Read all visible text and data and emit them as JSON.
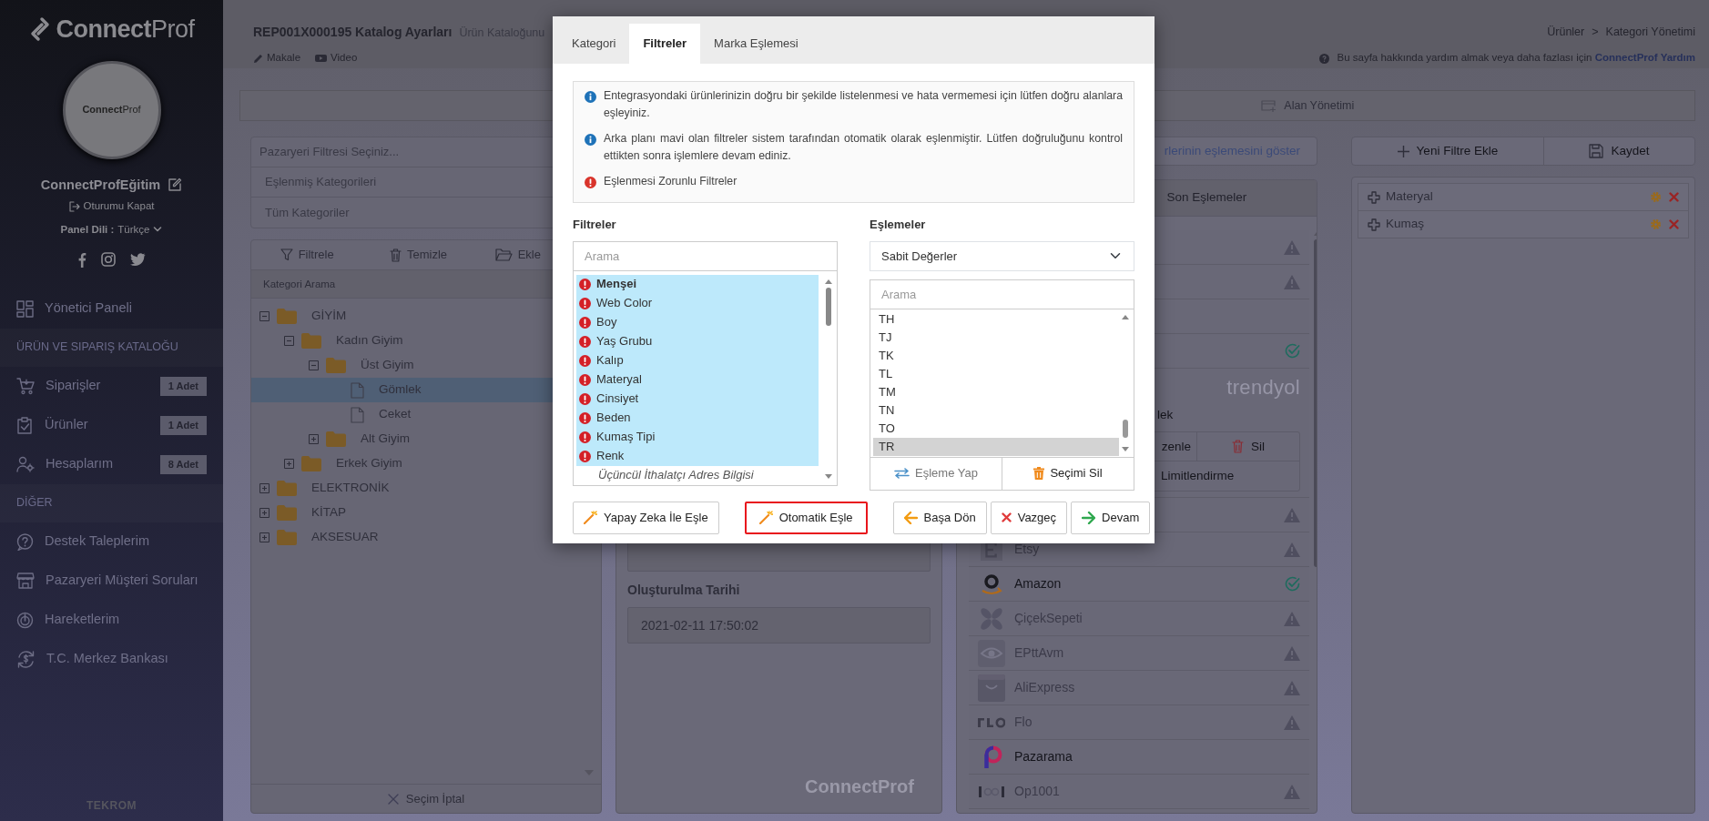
{
  "sidebar": {
    "logo": "**Connect**Prof",
    "avatar_logo": "**Connect**Prof",
    "user": "ConnectProfEğitim",
    "logout": "Oturumu Kapat",
    "language_label": "Panel Dili :",
    "language": "Türkçe",
    "menu": [
      {
        "kind": "item",
        "label": "Yönetici Paneli"
      },
      {
        "kind": "section",
        "label": "ÜRÜN VE SIPARIŞ KATALOĞU"
      },
      {
        "kind": "item",
        "label": "Siparişler",
        "badge": "1 Adet"
      },
      {
        "kind": "item",
        "label": "Ürünler",
        "badge": "1 Adet"
      },
      {
        "kind": "item",
        "label": "Hesaplarım",
        "badge": "8 Adet"
      },
      {
        "kind": "section",
        "label": "DİĞER"
      },
      {
        "kind": "item",
        "label": "Destek Taleplerim"
      },
      {
        "kind": "item",
        "label": "Pazaryeri Müşteri Soruları"
      },
      {
        "kind": "item",
        "label": "Hareketlerim"
      },
      {
        "kind": "item",
        "label": "T.C. Merkez Bankası"
      }
    ],
    "footer": "TEKROM"
  },
  "header": {
    "title": "REP001X000195 Katalog Ayarları",
    "subtitle": "Ürün Kataloğunu",
    "breadcrumb": [
      "Ürünler",
      "Kategori Yönetimi"
    ],
    "breadcrumb_separator": ">",
    "links": [
      "Makale",
      "Video"
    ],
    "help_text": "Bu sayfa hakkında yardım almak veya daha fazlası için",
    "help_link": "ConnectProf Yardım"
  },
  "page_tab": "Alan Yönetimi",
  "category_panel": {
    "filters": [
      "Pazaryeri Filtresi Seçiniz...",
      "Eşlenmiş Kategorileri",
      "Tüm Kategoriler"
    ],
    "toolbar": [
      "Filtrele",
      "Temizle",
      "Ekle"
    ],
    "search_placeholder": "Kategori Arama",
    "tree": [
      {
        "kind": "folder",
        "label": "GİYİM",
        "expanded": true,
        "selected": false,
        "children": [
          {
            "kind": "folder",
            "label": "Kadın Giyim",
            "expanded": true,
            "selected": false,
            "children": [
              {
                "kind": "folder",
                "label": "Üst Giyim",
                "expanded": true,
                "selected": false,
                "children": [
                  {
                    "kind": "file",
                    "label": "Gömlek",
                    "selected": true
                  },
                  {
                    "kind": "file",
                    "label": "Ceket",
                    "selected": false
                  }
                ]
              },
              {
                "kind": "folder",
                "label": "Alt Giyim",
                "expanded": false,
                "selected": false
              }
            ]
          },
          {
            "kind": "folder",
            "label": "Erkek Giyim",
            "expanded": false,
            "selected": false
          }
        ]
      },
      {
        "kind": "folder",
        "label": "ELEKTRONİK",
        "expanded": false,
        "selected": false
      },
      {
        "kind": "folder",
        "label": "KİTAP",
        "expanded": false,
        "selected": false
      },
      {
        "kind": "folder",
        "label": "AKSESUAR",
        "expanded": false,
        "selected": false
      }
    ],
    "cancel": "Seçim İptal"
  },
  "details": {
    "created_label": "Oluşturulma Tarihi",
    "created_value": "2021-02-11 17:50:02",
    "brand": "ConnectProf"
  },
  "mappings_panel": {
    "show_link": "rlerinin eşlemesini göster",
    "tab": "Son Eşlemeler",
    "marketplaces": [
      {
        "kind": "row",
        "warning": true,
        "verified": false
      },
      {
        "kind": "row",
        "warning": true,
        "verified": false
      },
      {
        "kind": "row",
        "warning": false,
        "verified": false
      },
      {
        "kind": "row",
        "warning": false,
        "verified": true
      },
      {
        "kind": "expanded",
        "logo": "trendyol",
        "product": "lek",
        "actions": [
          "zenle",
          "Sil"
        ],
        "limit": "Limitlendirme"
      },
      {
        "kind": "row",
        "warning": true,
        "verified": false
      },
      {
        "kind": "row",
        "name": "Etsy",
        "warning": true,
        "verified": false
      },
      {
        "kind": "row",
        "name": "Amazon",
        "warning": false,
        "verified": true
      },
      {
        "kind": "row",
        "name": "ÇiçekSepeti",
        "warning": true,
        "verified": false
      },
      {
        "kind": "row",
        "name": "EPttAvm",
        "warning": true,
        "verified": false
      },
      {
        "kind": "row",
        "name": "AliExpress",
        "warning": true,
        "verified": false
      },
      {
        "kind": "row",
        "name": "Flo",
        "warning": true,
        "verified": false
      },
      {
        "kind": "row",
        "name": "Pazarama",
        "warning": false,
        "verified": false
      },
      {
        "kind": "row",
        "name": "Op1001",
        "warning": true,
        "verified": false
      }
    ]
  },
  "filters_panel": {
    "buttons": [
      "Yeni Filtre Ekle",
      "Kaydet"
    ],
    "items": [
      "Materyal",
      "Kumaş"
    ]
  },
  "modal": {
    "tabs": [
      {
        "label": "Kategori",
        "selected": false
      },
      {
        "label": "Filtreler",
        "selected": true
      },
      {
        "label": "Marka Eşlemesi",
        "selected": false
      }
    ],
    "notes": [
      {
        "kind": "info",
        "text": "Entegrasyondaki ürünlerinizin doğru bir şekilde listelenmesi ve hata vermemesi için lütfen doğru alanlara eşleyiniz."
      },
      {
        "kind": "info",
        "text": "Arka planı mavi olan filtreler sistem tarafından otomatik olarak eşlenmiştir. Lütfen doğruluğunu kontrol ettikten sonra işlemlere devam ediniz."
      },
      {
        "kind": "required",
        "text": "Eşlenmesi Zorunlu Filtreler"
      }
    ],
    "filters": {
      "label": "Filtreler",
      "placeholder": "Arama",
      "items": [
        {
          "label": "Menşei",
          "selected": true,
          "mapped": true,
          "required": true
        },
        {
          "label": "Web Color",
          "selected": false,
          "mapped": true,
          "required": true
        },
        {
          "label": "Boy",
          "selected": false,
          "mapped": true,
          "required": true
        },
        {
          "label": "Yaş Grubu",
          "selected": false,
          "mapped": true,
          "required": true
        },
        {
          "label": "Kalıp",
          "selected": false,
          "mapped": true,
          "required": true
        },
        {
          "label": "Materyal",
          "selected": false,
          "mapped": true,
          "required": true
        },
        {
          "label": "Cinsiyet",
          "selected": false,
          "mapped": true,
          "required": true
        },
        {
          "label": "Beden",
          "selected": false,
          "mapped": true,
          "required": true
        },
        {
          "label": "Kumaş Tipi",
          "selected": false,
          "mapped": true,
          "required": true
        },
        {
          "label": "Renk",
          "selected": false,
          "mapped": true,
          "required": true
        },
        {
          "label": "Üçüncül İthalatçı Adres Bilgisi",
          "selected": false,
          "mapped": false,
          "required": false
        }
      ]
    },
    "mappings": {
      "label": "Eşlemeler",
      "select": "Sabit Değerler",
      "placeholder": "Arama",
      "values": [
        {
          "label": "TH",
          "selected": false
        },
        {
          "label": "TJ",
          "selected": false
        },
        {
          "label": "TK",
          "selected": false
        },
        {
          "label": "TL",
          "selected": false
        },
        {
          "label": "TM",
          "selected": false
        },
        {
          "label": "TN",
          "selected": false
        },
        {
          "label": "TO",
          "selected": false
        },
        {
          "label": "TR",
          "selected": true
        }
      ],
      "actions": [
        "Eşleme Yap",
        "Seçimi Sil"
      ]
    },
    "left_buttons": [
      {
        "label": "Yapay Zeka İle Eşle",
        "highlighted": false
      },
      {
        "label": "Otomatik Eşle",
        "highlighted": true
      }
    ],
    "right_buttons": [
      "Başa Dön",
      "Vazgeç",
      "Devam"
    ]
  }
}
